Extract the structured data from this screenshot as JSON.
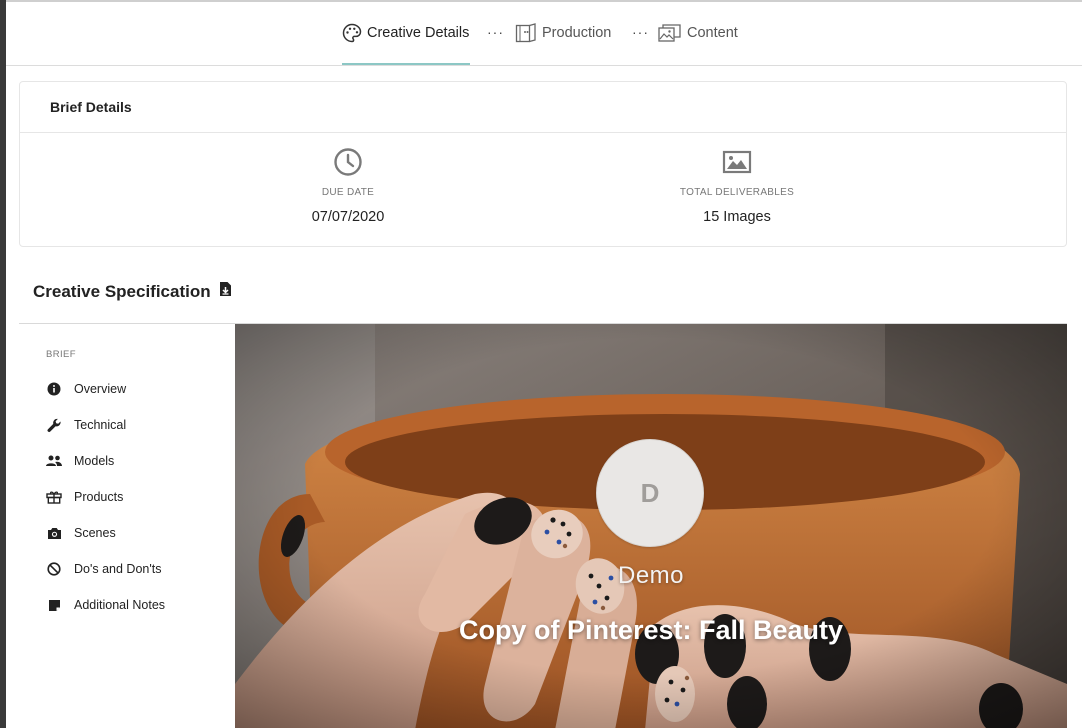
{
  "stepper": {
    "steps": [
      {
        "label": "Creative Details",
        "icon": "palette-icon",
        "active": true
      },
      {
        "label": "Production",
        "icon": "production-icon",
        "active": false
      },
      {
        "label": "Content",
        "icon": "gallery-icon",
        "active": false
      }
    ],
    "separator": "···"
  },
  "brief_card": {
    "title": "Brief Details",
    "due_date": {
      "label": "DUE DATE",
      "value": "07/07/2020",
      "icon": "clock-icon"
    },
    "deliverables": {
      "label": "TOTAL DELIVERABLES",
      "value": "15 Images",
      "icon": "image-icon"
    }
  },
  "spec": {
    "title": "Creative Specification",
    "download_icon": "file-download-icon"
  },
  "sidebar": {
    "section_label": "BRIEF",
    "items": [
      {
        "label": "Overview",
        "icon": "info-icon"
      },
      {
        "label": "Technical",
        "icon": "wrench-icon"
      },
      {
        "label": "Models",
        "icon": "people-icon"
      },
      {
        "label": "Products",
        "icon": "gift-box-icon"
      },
      {
        "label": "Scenes",
        "icon": "camera-icon"
      },
      {
        "label": "Do's and Don'ts",
        "icon": "block-icon"
      },
      {
        "label": "Additional Notes",
        "icon": "note-icon"
      }
    ]
  },
  "hero": {
    "avatar_letter": "D",
    "brand_name": "Demo",
    "brief_name": "Copy of Pinterest: Fall Beauty"
  },
  "colors": {
    "accent_underline": "#8cc7c5",
    "mug_orange": "#c9793f"
  }
}
